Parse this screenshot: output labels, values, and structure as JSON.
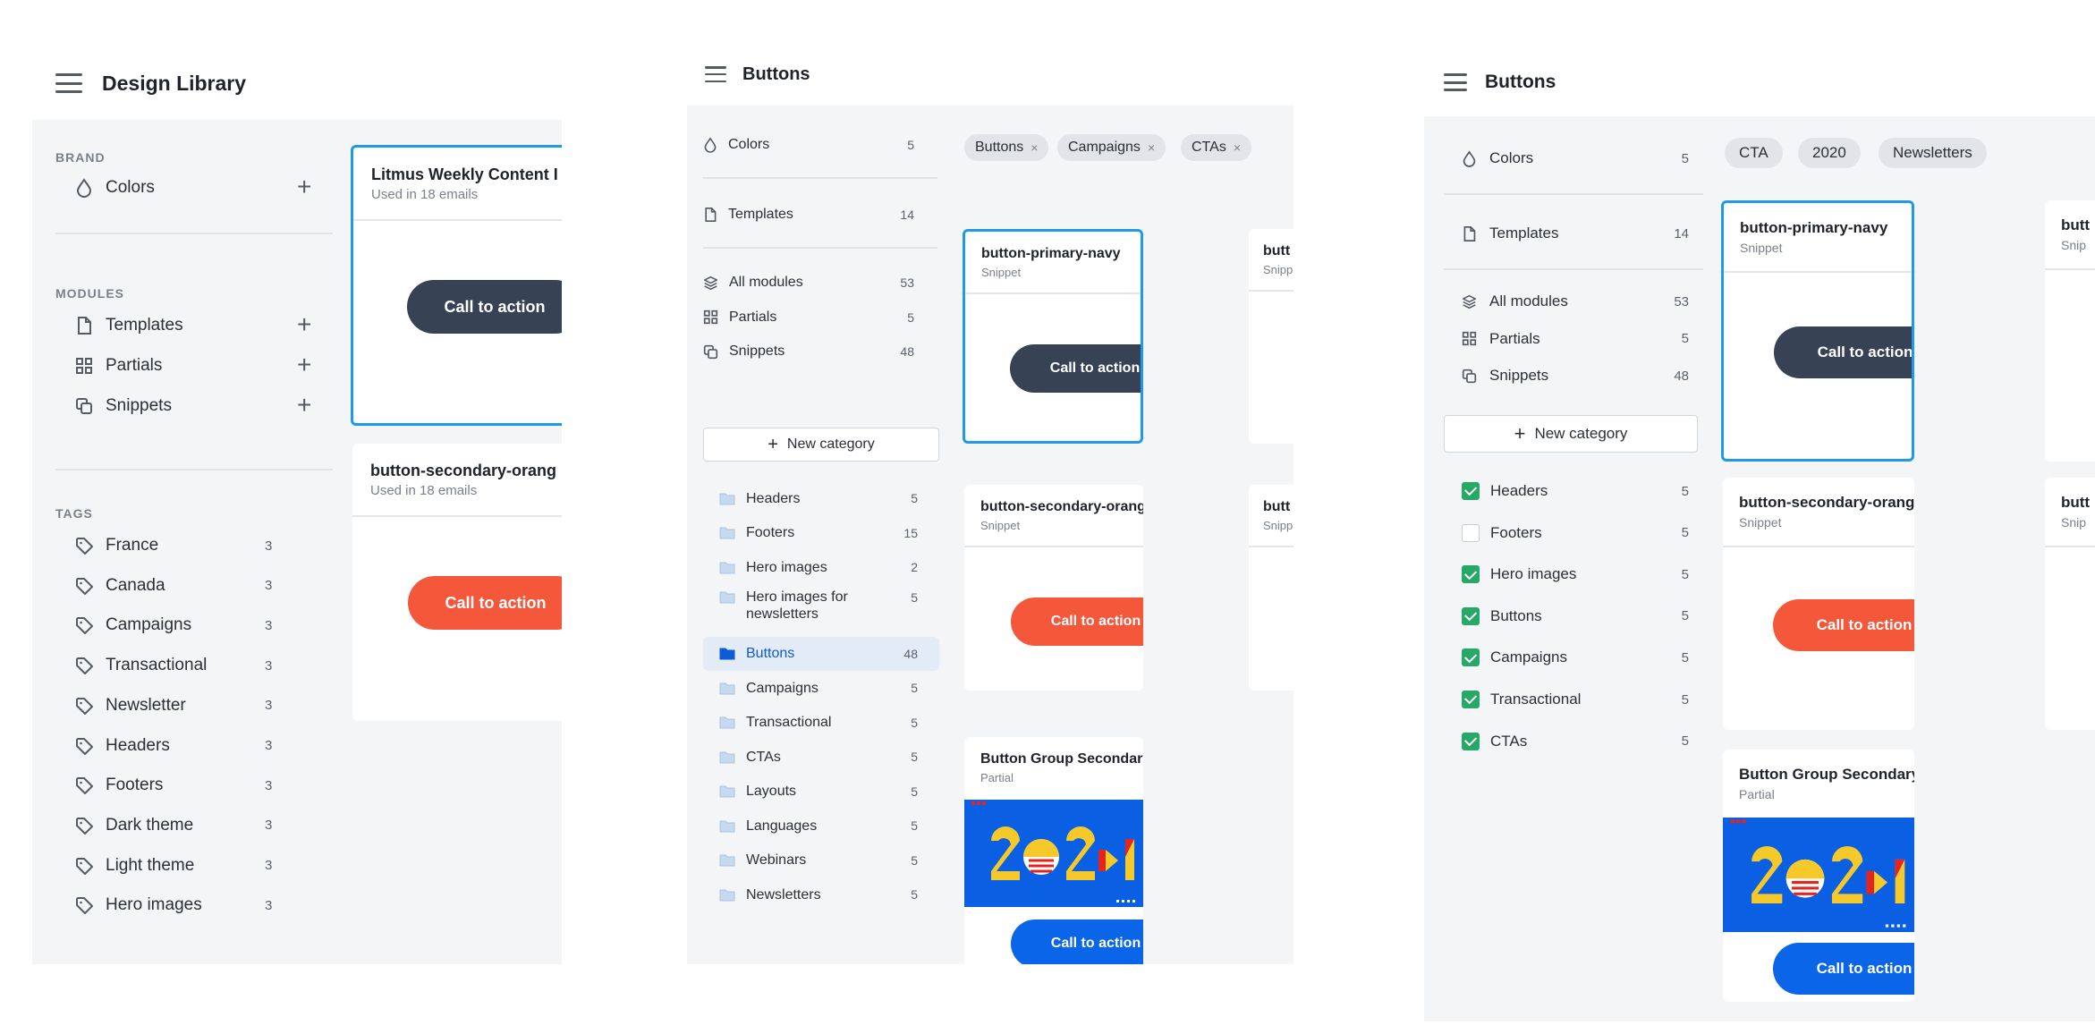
{
  "panel1": {
    "title": "Design Library",
    "brand_label": "BRAND",
    "brand_items": [
      {
        "label": "Colors"
      }
    ],
    "modules_label": "MODULES",
    "module_items": [
      {
        "label": "Templates"
      },
      {
        "label": "Partials"
      },
      {
        "label": "Snippets"
      }
    ],
    "tags_label": "TAGS",
    "tags": [
      {
        "label": "France",
        "count": "3"
      },
      {
        "label": "Canada",
        "count": "3"
      },
      {
        "label": "Campaigns",
        "count": "3"
      },
      {
        "label": "Transactional",
        "count": "3"
      },
      {
        "label": "Newsletter",
        "count": "3"
      },
      {
        "label": "Headers",
        "count": "3"
      },
      {
        "label": "Footers",
        "count": "3"
      },
      {
        "label": "Dark theme",
        "count": "3"
      },
      {
        "label": "Light theme",
        "count": "3"
      },
      {
        "label": "Hero images",
        "count": "3"
      }
    ],
    "plus": "+",
    "cards": [
      {
        "title": "Litmus Weekly Content I",
        "sub": "Used in 18 emails",
        "button": "Call to action"
      },
      {
        "title": "button-secondary-orang",
        "sub": "Used in 18 emails",
        "button": "Call to action"
      }
    ]
  },
  "panel2": {
    "title": "Buttons",
    "colors": {
      "label": "Colors",
      "count": "5"
    },
    "templates": {
      "label": "Templates",
      "count": "14"
    },
    "modules": [
      {
        "label": "All modules",
        "count": "53"
      },
      {
        "label": "Partials",
        "count": "5"
      },
      {
        "label": "Snippets",
        "count": "48"
      }
    ],
    "new_category": "New category",
    "folders": [
      {
        "label": "Headers",
        "count": "5"
      },
      {
        "label": "Footers",
        "count": "15"
      },
      {
        "label": "Hero images",
        "count": "2"
      },
      {
        "label": "Hero images for newsletters",
        "count": "5"
      },
      {
        "label": "Buttons",
        "count": "48"
      },
      {
        "label": "Campaigns",
        "count": "5"
      },
      {
        "label": "Transactional",
        "count": "5"
      },
      {
        "label": "CTAs",
        "count": "5"
      },
      {
        "label": "Layouts",
        "count": "5"
      },
      {
        "label": "Languages",
        "count": "5"
      },
      {
        "label": "Webinars",
        "count": "5"
      },
      {
        "label": "Newsletters",
        "count": "5"
      }
    ],
    "chips": [
      {
        "label": "Buttons"
      },
      {
        "label": "Campaigns"
      },
      {
        "label": "CTAs"
      }
    ],
    "chip_close": "×",
    "cards": [
      {
        "title": "button-primary-navy",
        "sub": "Snippet",
        "button": "Call to action"
      },
      {
        "title": "button-secondary-orange",
        "sub": "Snippet",
        "button": "Call to action"
      },
      {
        "title": "Button Group Secondary",
        "sub": "Partial",
        "button": "Call to action"
      }
    ],
    "peek_cards": [
      {
        "title": "butt",
        "sub": "Snipp"
      },
      {
        "title": "butt",
        "sub": "Snipp"
      }
    ]
  },
  "panel3": {
    "title": "Buttons",
    "colors": {
      "label": "Colors",
      "count": "5"
    },
    "templates": {
      "label": "Templates",
      "count": "14"
    },
    "modules": [
      {
        "label": "All modules",
        "count": "53"
      },
      {
        "label": "Partials",
        "count": "5"
      },
      {
        "label": "Snippets",
        "count": "48"
      }
    ],
    "new_category": "New category",
    "checks": [
      {
        "label": "Headers",
        "count": "5",
        "checked": true
      },
      {
        "label": "Footers",
        "count": "5",
        "checked": false
      },
      {
        "label": "Hero images",
        "count": "5",
        "checked": true
      },
      {
        "label": "Buttons",
        "count": "5",
        "checked": true
      },
      {
        "label": "Campaigns",
        "count": "5",
        "checked": true
      },
      {
        "label": "Transactional",
        "count": "5",
        "checked": true
      },
      {
        "label": "CTAs",
        "count": "5",
        "checked": true
      }
    ],
    "chips": [
      {
        "label": "CTA"
      },
      {
        "label": "2020"
      },
      {
        "label": "Newsletters"
      }
    ],
    "cards": [
      {
        "title": "button-primary-navy",
        "sub": "Snippet",
        "button": "Call to action"
      },
      {
        "title": "button-secondary-orange",
        "sub": "Snippet",
        "button": "Call to action"
      },
      {
        "title": "Button Group Secondary",
        "sub": "Partial",
        "button": "Call to action"
      }
    ],
    "peek_cards": [
      {
        "title": "butt",
        "sub": "Snip"
      },
      {
        "title": "butt",
        "sub": "Snip"
      }
    ]
  },
  "colors": {
    "navy_button": "#374355",
    "orange_button": "#f5573b",
    "blue_button": "#0a65e8",
    "selected_border": "#1f9ae8",
    "check_green": "#27a867",
    "active_folder": "#0d5bd7"
  }
}
